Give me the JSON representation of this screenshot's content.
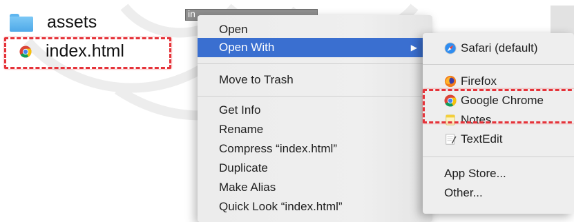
{
  "finder": {
    "items": [
      {
        "label": "assets",
        "icon": "folder-icon"
      },
      {
        "label": "index.html",
        "icon": "chrome-icon"
      }
    ],
    "rename_text": "in"
  },
  "context_menu": {
    "items": [
      {
        "label": "Open"
      },
      {
        "label": "Open With",
        "selected": true,
        "arrow": "▶"
      },
      {
        "label": "Move to Trash"
      },
      {
        "label": "Get Info"
      },
      {
        "label": "Rename"
      },
      {
        "label": "Compress “index.html”"
      },
      {
        "label": "Duplicate"
      },
      {
        "label": "Make Alias"
      },
      {
        "label": "Quick Look “index.html”"
      }
    ]
  },
  "open_with_submenu": {
    "items": [
      {
        "label": "Safari (default)",
        "icon": "safari-icon"
      },
      {
        "label": "Firefox",
        "icon": "firefox-icon"
      },
      {
        "label": "Google Chrome",
        "icon": "chrome-icon"
      },
      {
        "label": "Notes",
        "icon": "notes-icon"
      },
      {
        "label": "TextEdit",
        "icon": "textedit-icon"
      },
      {
        "label": "App Store..."
      },
      {
        "label": "Other..."
      }
    ]
  },
  "colors": {
    "selection": "#3a6fd0",
    "highlight_outline": "#e5333a"
  }
}
